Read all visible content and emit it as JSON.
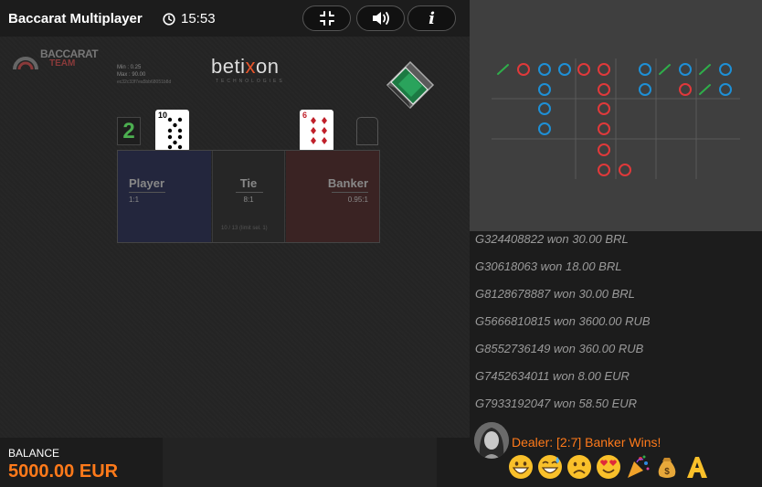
{
  "header": {
    "title": "Baccarat Multiplayer",
    "time": "15:53",
    "info_label": "i"
  },
  "table": {
    "brand_line1": "BACCARAT",
    "brand_line2": "TEAM",
    "limits_min": "Min : 0.25",
    "limits_max": "Max : 90.00",
    "table_id": "ec32c33f7ea5bb68051b8d",
    "provider_pre": "beti",
    "provider_x": "x",
    "provider_post": "on",
    "provider_sub": "TECHNOLOGIES",
    "player_score": "2",
    "player_card_rank": "10",
    "banker_card_rank": "6",
    "bets": {
      "player": {
        "name": "Player",
        "odds": "1:1"
      },
      "tie": {
        "name": "Tie",
        "odds": "8:1",
        "limit": "10 / 13 (limit sel. 1)"
      },
      "banker": {
        "name": "Banker",
        "odds": "0.95:1"
      }
    }
  },
  "balance": {
    "label": "BALANCE",
    "value": "5000.00 EUR"
  },
  "colors": {
    "accent_orange": "#ff7a1a",
    "player_blue": "#1e90d6",
    "banker_red": "#e0393a",
    "tie_green": "#2fae4a",
    "score_green": "#4caf50"
  },
  "feed": {
    "wins": [
      "G324408822 won 30.00 BRL",
      "G30618063 won 18.00 BRL",
      "G8128678887 won 30.00 BRL",
      "G5666810815 won 3600.00 RUB",
      "G8552736149 won 360.00 RUB",
      "G7452634011 won 8.00 EUR",
      "G7933192047 won 58.50 EUR"
    ],
    "dealer_message": "Dealer: [2:7] Banker Wins!",
    "emojis": [
      "grinning-face",
      "smiling-face-with-sweat",
      "sad-face",
      "heart-eyes-face",
      "party-popper",
      "money-bag",
      "text-a-icon"
    ]
  }
}
